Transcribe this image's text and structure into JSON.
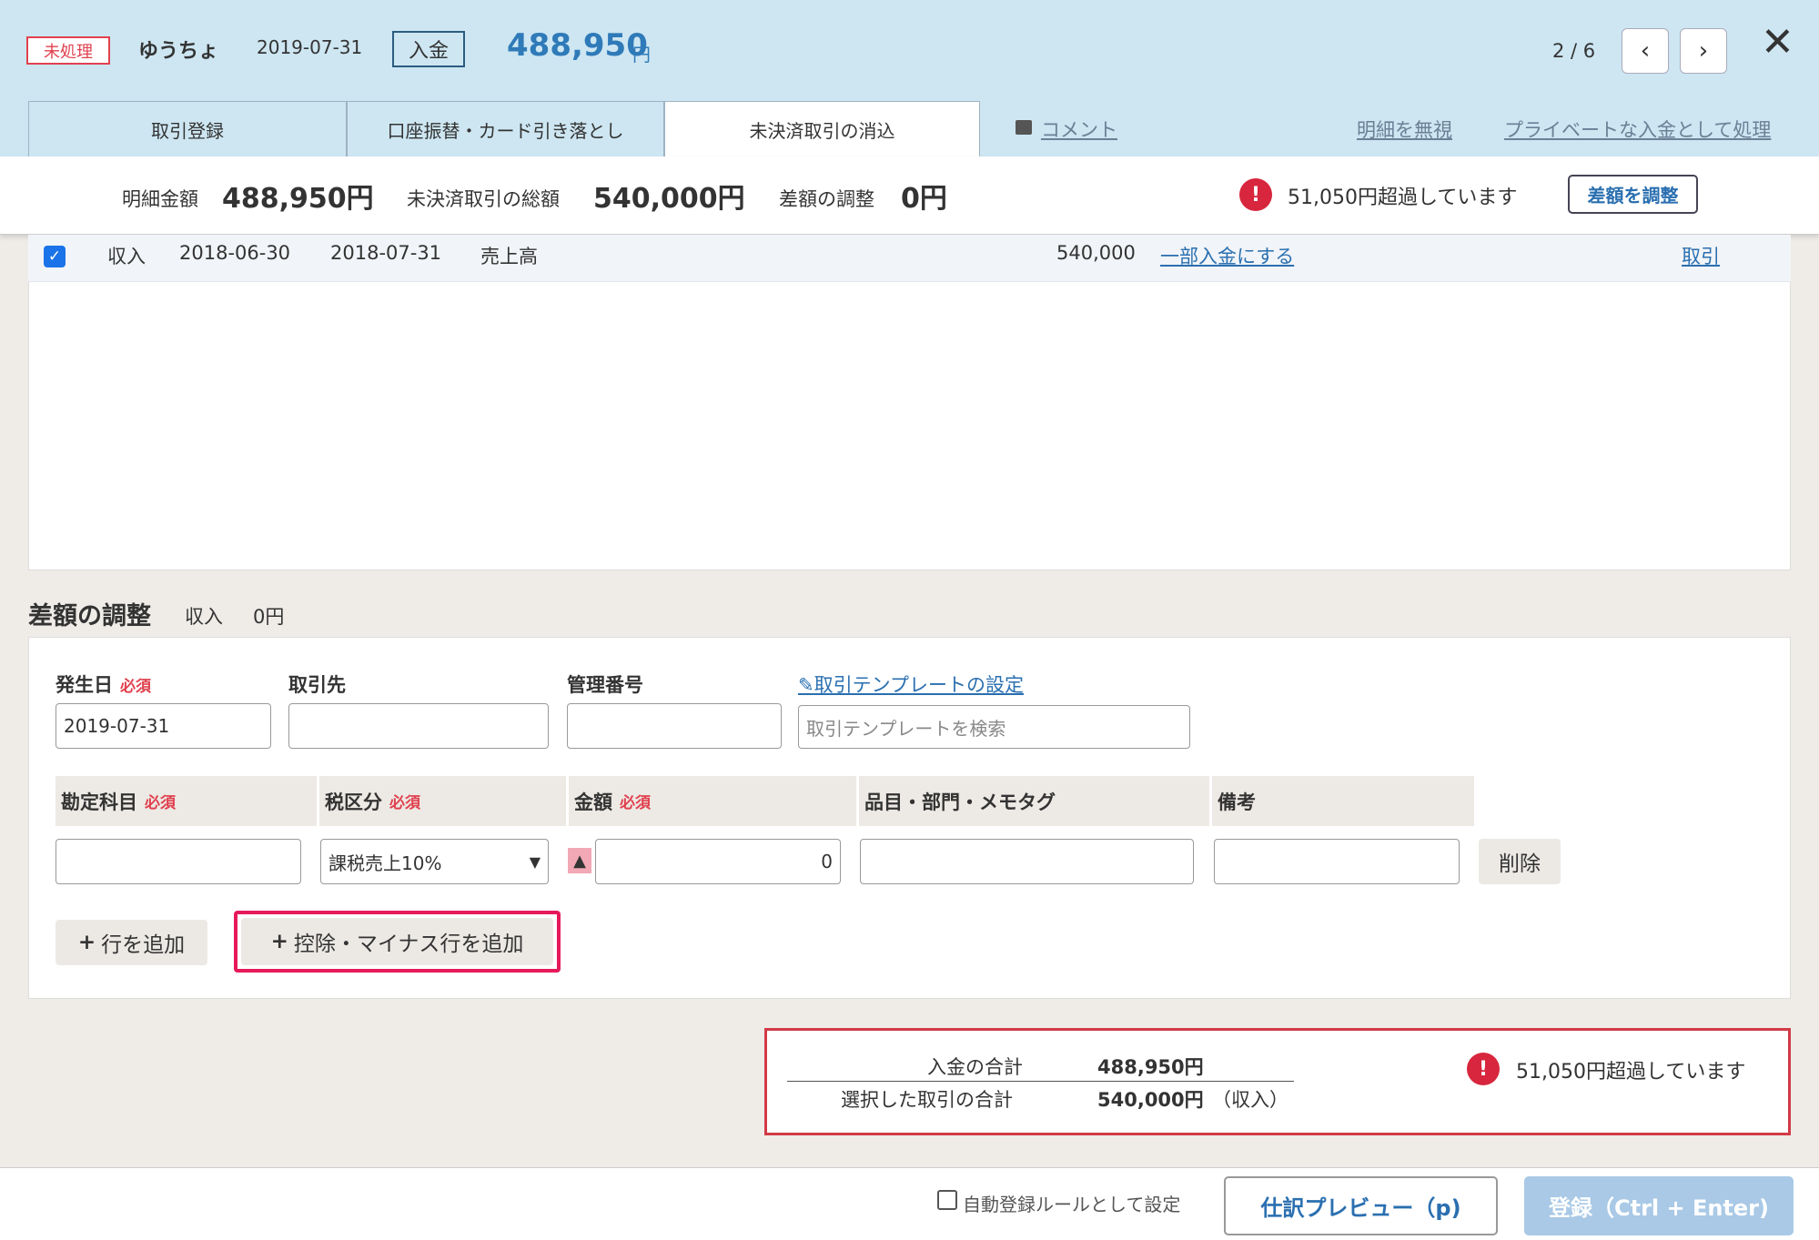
{
  "header": {
    "status_badge": "未処理",
    "bank_name": "ゆうちょ",
    "date": "2019-07-31",
    "type": "入金",
    "amount": "488,950",
    "unit": "円",
    "pager": "2 / 6",
    "prev_icon": "chevron-left-icon",
    "next_icon": "chevron-right-icon",
    "close_icon": "close-icon"
  },
  "tabs": [
    {
      "label": "取引登録",
      "active": false
    },
    {
      "label": "口座振替・カード引き落とし",
      "active": false
    },
    {
      "label": "未決済取引の消込",
      "active": true
    }
  ],
  "header_links": {
    "comment": "コメント",
    "ignore": "明細を無視",
    "private": "プライベートな入金として処理"
  },
  "summary": {
    "detail_amount_label": "明細金額",
    "detail_amount": "488,950円",
    "unsettled_total_label": "未決済取引の総額",
    "unsettled_total": "540,000円",
    "diff_label": "差額の調整",
    "diff_value": "0円",
    "alert": "51,050円超過しています",
    "adjust_button": "差額を調整"
  },
  "transactions": [
    {
      "checked": true,
      "type": "収入",
      "date1": "2018-06-30",
      "date2": "2018-07-31",
      "account": "売上高",
      "amount": "540,000",
      "partial_link": "一部入金にする",
      "txn_link": "取引"
    }
  ],
  "adjustment": {
    "title": "差額の調整",
    "type": "収入",
    "amount": "0円",
    "required_label": "必須",
    "fields": {
      "date_label": "発生日",
      "date_value": "2019-07-31",
      "partner_label": "取引先",
      "partner_value": "",
      "mgmt_label": "管理番号",
      "mgmt_value": "",
      "template_link": "取引テンプレートの設定",
      "template_placeholder": "取引テンプレートを検索"
    },
    "columns": {
      "account": "勘定科目",
      "tax": "税区分",
      "amount": "金額",
      "item": "品目・部門・メモタグ",
      "note": "備考"
    },
    "row": {
      "account": "",
      "tax": "課税売上10%",
      "minus_mark": "▲",
      "amount": "0",
      "item": "",
      "note": "",
      "delete": "削除"
    },
    "add_row": "行を追加",
    "add_minus_row": "控除・マイナス行を追加"
  },
  "totals": {
    "deposit_label": "入金の合計",
    "deposit_value": "488,950円",
    "selected_label": "選択した取引の合計",
    "selected_value": "540,000円",
    "selected_type": "（収入）",
    "alert": "51,050円超過しています"
  },
  "footer": {
    "auto_rule_label": "自動登録ルールとして設定",
    "auto_rule_checked": false,
    "preview_button": "仕訳プレビュー（p)",
    "register_button": "登録（Ctrl + Enter)"
  },
  "colors": {
    "header_bg": "#cde6f2",
    "accent_blue": "#2f7ab8",
    "alert_red": "#d7263d",
    "highlight_pink": "#e6195a"
  }
}
